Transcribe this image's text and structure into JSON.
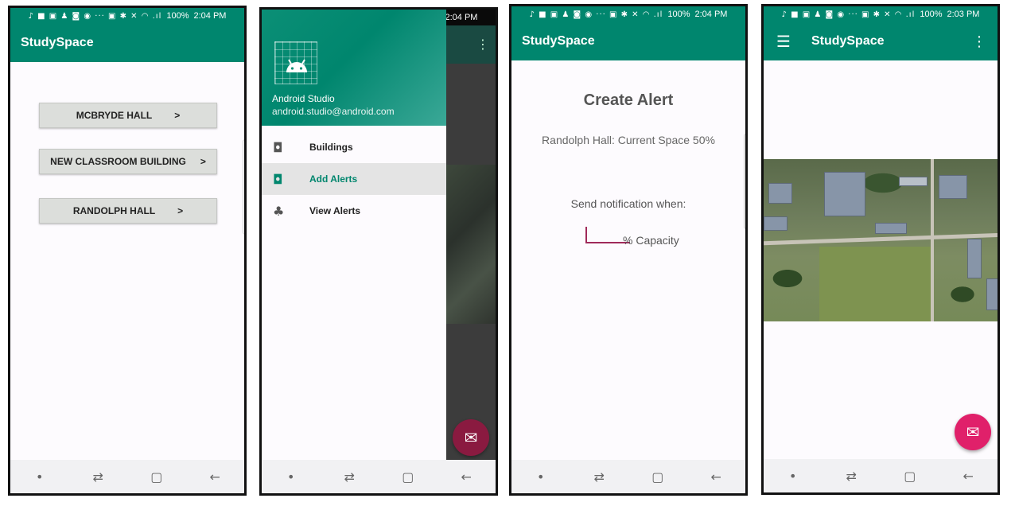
{
  "status": {
    "icons": "♪ ■ ▣ ♟ ◙ ◉ ··· ▣ ✱ ✕ ◠ .ıl",
    "battery": "100%",
    "times": [
      "2:04 PM",
      "2:04 PM",
      "2:04 PM",
      "2:03 PM"
    ]
  },
  "app": {
    "title": "StudySpace"
  },
  "buildings": {
    "items": [
      {
        "label": "MCBRYDE HALL",
        "arrow": ">"
      },
      {
        "label": "NEW CLASSROOM BUILDING",
        "arrow": ">"
      },
      {
        "label": "RANDOLPH HALL",
        "arrow": ">"
      }
    ]
  },
  "drawer": {
    "user_name": "Android Studio",
    "user_email": "android.studio@android.com",
    "items": [
      {
        "label": "Buildings",
        "icon": "camera-icon",
        "glyph": "◘"
      },
      {
        "label": "Add Alerts",
        "icon": "camera-icon",
        "glyph": "◘",
        "active": true
      },
      {
        "label": "View Alerts",
        "icon": "add-alert-icon",
        "glyph": "♣"
      }
    ]
  },
  "create_alert": {
    "title": "Create Alert",
    "current_space": "Randolph Hall: Current Space 50%",
    "send_when": "Send notification when:",
    "capacity_suffix": "% Capacity",
    "capacity_value": ""
  },
  "navbar": {
    "dot": "•",
    "recents": "⇄",
    "home": "▢",
    "back": "←"
  },
  "fab": {
    "icon": "mail-icon",
    "glyph": "✉"
  },
  "colors": {
    "primary": "#00866e",
    "accent": "#e0206a",
    "button": "#dcdedb"
  }
}
